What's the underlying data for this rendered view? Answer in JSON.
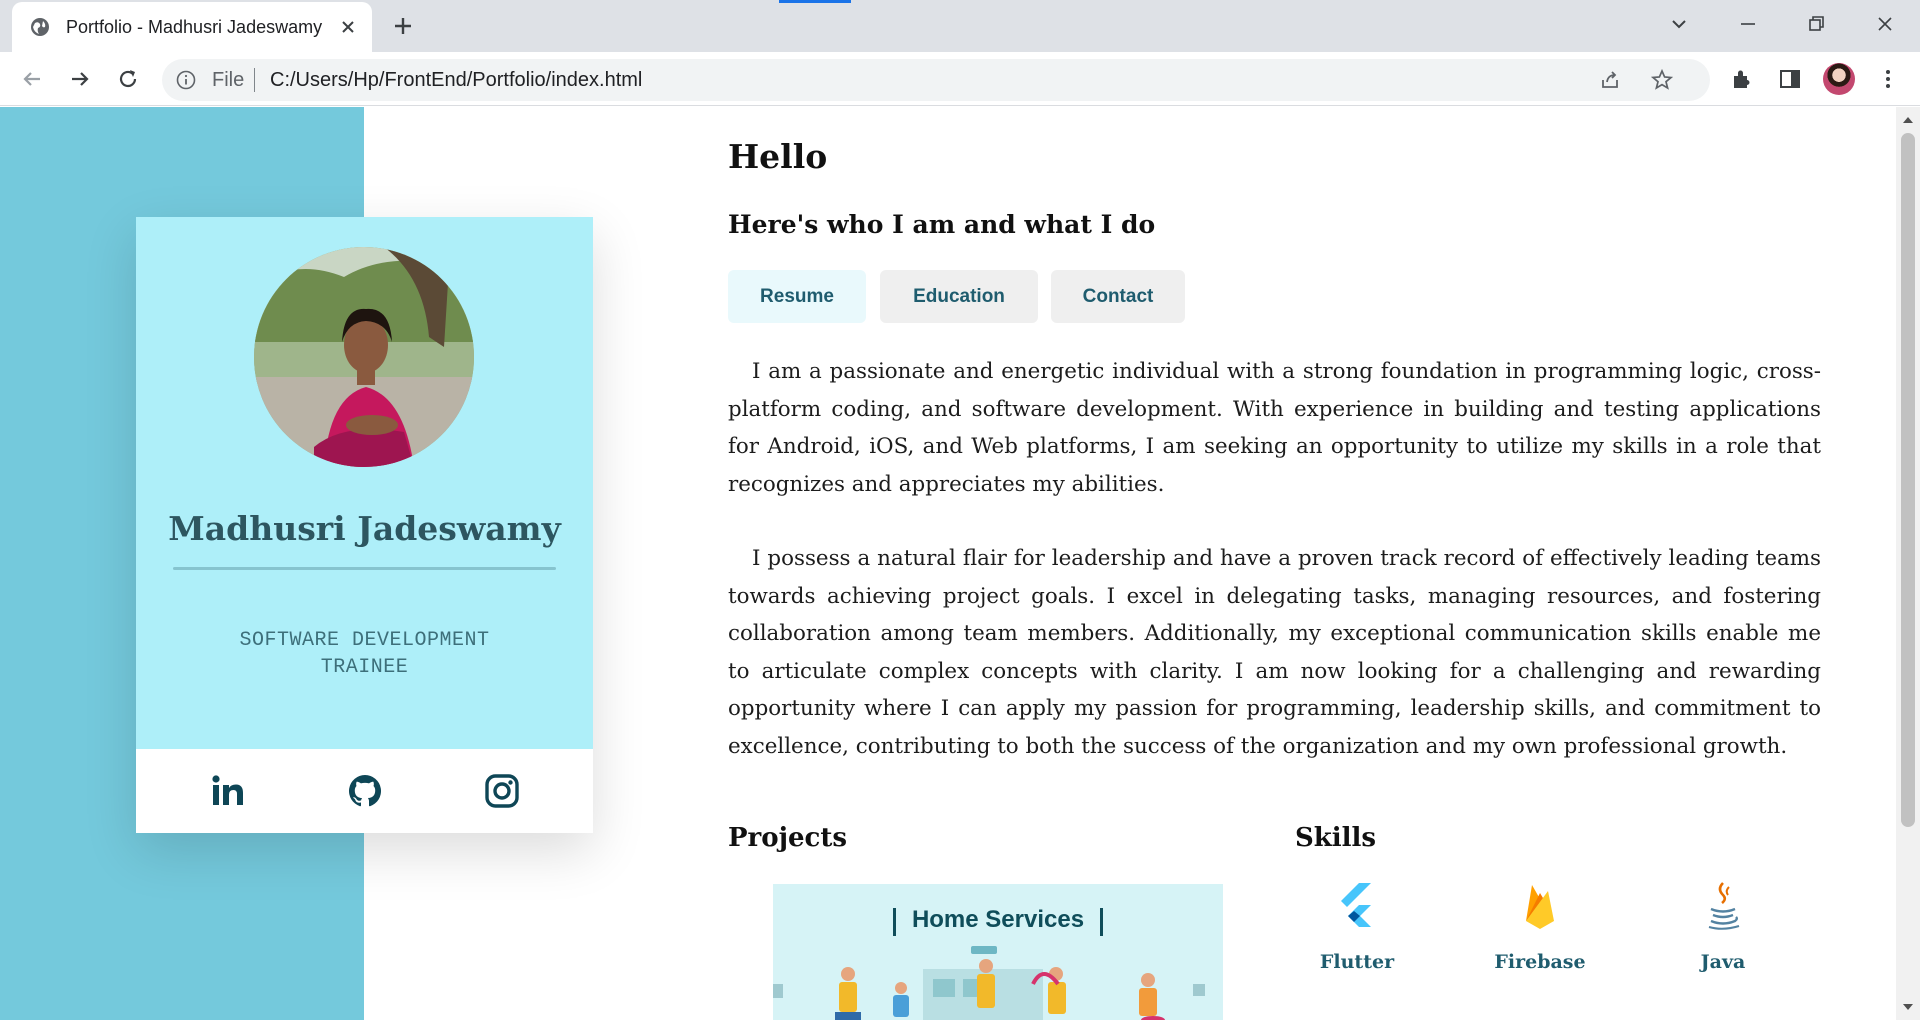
{
  "browser": {
    "tab_title": "Portfolio - Madhusri Jadeswamy",
    "omnibox_scheme_label": "File",
    "url": "C:/Users/Hp/FrontEnd/Portfolio/index.html"
  },
  "profile": {
    "name": "Madhusri Jadeswamy",
    "job_title": "SOFTWARE DEVELOPMENT TRAINEE",
    "social": [
      "linkedin-icon",
      "github-icon",
      "instagram-icon"
    ]
  },
  "main": {
    "greeting": "Hello",
    "subheading": "Here's who I am and what I do",
    "tabs": [
      {
        "label": "Resume",
        "active": true
      },
      {
        "label": "Education",
        "active": false
      },
      {
        "label": "Contact",
        "active": false
      }
    ],
    "paragraphs": [
      "I am a passionate and energetic individual with a strong foundation in programming logic, cross-platform coding, and software development. With experience in building and testing applications for Android, iOS, and Web platforms, I am seeking an opportunity to utilize my skills in a role that recognizes and appreciates my abilities.",
      "I possess a natural flair for leadership and have a proven track record of effectively leading teams towards achieving project goals. I excel in delegating tasks, managing resources, and fostering collaboration among team members. Additionally, my exceptional communication skills enable me to articulate complex concepts with clarity. I am now looking for a challenging and rewarding opportunity where I can apply my passion for programming, leadership skills, and commitment to excellence, contributing to both the success of the organization and my own professional growth."
    ],
    "projects": {
      "heading": "Projects",
      "items": [
        {
          "title": "Home Services"
        }
      ]
    },
    "skills": {
      "heading": "Skills",
      "items": [
        {
          "label": "Flutter",
          "icon": "flutter-icon"
        },
        {
          "label": "Firebase",
          "icon": "firebase-icon"
        },
        {
          "label": "Java",
          "icon": "java-icon"
        }
      ]
    }
  },
  "colors": {
    "left_band": "#74c9dc",
    "card": "#aeeff9",
    "accent_text": "#1f5c6e"
  }
}
